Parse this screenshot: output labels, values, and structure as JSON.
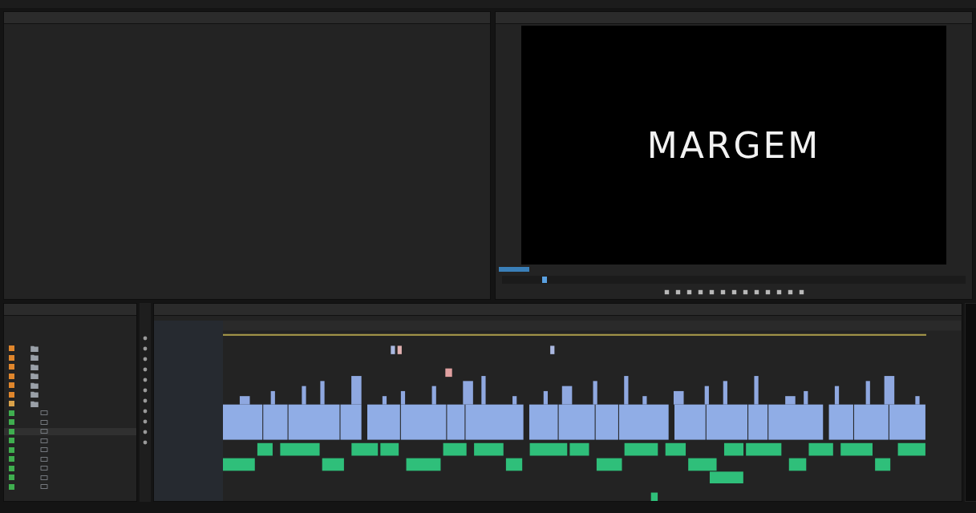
{
  "program_monitor": {
    "frame_text": "MARGEM"
  },
  "project_panel": {
    "items": [
      {
        "kind": "folder",
        "color": "#e0862c"
      },
      {
        "kind": "folder",
        "color": "#e0862c"
      },
      {
        "kind": "folder",
        "color": "#e0862c"
      },
      {
        "kind": "folder",
        "color": "#e0862c"
      },
      {
        "kind": "folder",
        "color": "#e0862c"
      },
      {
        "kind": "folder",
        "color": "#e0862c"
      },
      {
        "kind": "folder",
        "color": "#d9a24a"
      },
      {
        "kind": "clip",
        "color": "#3fae4f"
      },
      {
        "kind": "clip",
        "color": "#3fae4f"
      },
      {
        "kind": "clip",
        "color": "#3fae4f"
      },
      {
        "kind": "clip",
        "color": "#3fae4f"
      },
      {
        "kind": "clip",
        "color": "#3fae4f"
      },
      {
        "kind": "clip",
        "color": "#3fae4f"
      },
      {
        "kind": "clip",
        "color": "#3fae4f"
      },
      {
        "kind": "clip",
        "color": "#3fae4f"
      },
      {
        "kind": "clip",
        "color": "#3fae4f"
      }
    ]
  }
}
